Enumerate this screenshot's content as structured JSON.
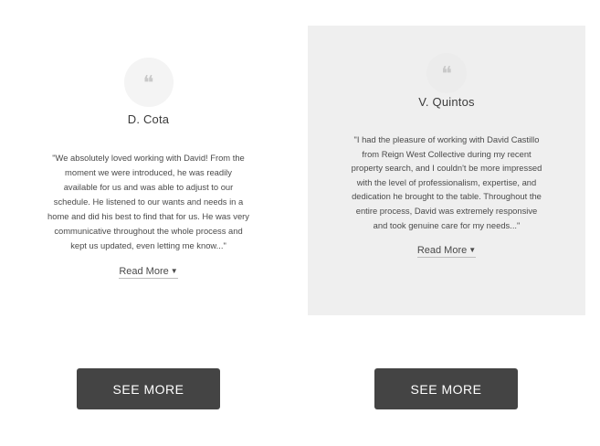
{
  "testimonials": [
    {
      "icon": "quote-icon",
      "quote_mark": "❝",
      "name": "D. Cota",
      "text": "\"We absolutely loved working with David! From the moment we were introduced, he was readily available for us and was able to adjust to our schedule. He listened to our wants and needs in a home and did his best to find that for us. He was very communicative throughout the whole process and kept us updated, even letting me know...\"",
      "read_more": "Read More",
      "background": "#ffffff"
    },
    {
      "icon": "quote-icon",
      "quote_mark": "❝",
      "name": "V. Quintos",
      "text": "\"I had the pleasure of working with David Castillo from Reign West Collective during my recent property search, and I couldn't be more impressed with the level of professionalism, expertise, and dedication he brought to the table. Throughout the entire process, David was extremely responsive and took genuine care for my needs...\"",
      "read_more": "Read More",
      "background": "#efefef"
    }
  ],
  "buttons": [
    {
      "label": "SEE MORE"
    },
    {
      "label": "SEE MORE"
    }
  ],
  "colors": {
    "button_bg": "#444444",
    "button_text": "#ffffff",
    "card_highlight": "#efefef"
  }
}
